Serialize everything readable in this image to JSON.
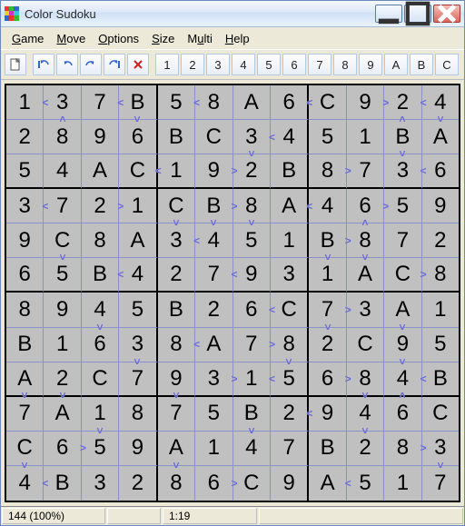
{
  "window": {
    "title": "Color Sudoku"
  },
  "menu": {
    "items": [
      {
        "label": "Game",
        "ul": 0
      },
      {
        "label": "Move",
        "ul": 0
      },
      {
        "label": "Options",
        "ul": 0
      },
      {
        "label": "Size",
        "ul": 0
      },
      {
        "label": "Multi",
        "ul": 1
      },
      {
        "label": "Help",
        "ul": 0
      }
    ]
  },
  "toolbar": {
    "new_icon": "new-file-icon",
    "undo_icons": [
      "undo-step-icon",
      "undo-icon",
      "redo-icon",
      "redo-step-icon"
    ],
    "cancel_icon": "cancel-icon",
    "numbers": [
      "1",
      "2",
      "3",
      "4",
      "5",
      "6",
      "7",
      "8",
      "9",
      "A",
      "B",
      "C"
    ]
  },
  "grid": [
    [
      "1",
      "3",
      "7",
      "B",
      "5",
      "8",
      "A",
      "6",
      "C",
      "9",
      "2",
      "4"
    ],
    [
      "2",
      "8",
      "9",
      "6",
      "B",
      "C",
      "3",
      "4",
      "5",
      "1",
      "B",
      "A"
    ],
    [
      "5",
      "4",
      "A",
      "C",
      "1",
      "9",
      "2",
      "B",
      "8",
      "7",
      "3",
      "6"
    ],
    [
      "3",
      "7",
      "2",
      "1",
      "C",
      "B",
      "8",
      "A",
      "4",
      "6",
      "5",
      "9"
    ],
    [
      "9",
      "C",
      "8",
      "A",
      "3",
      "4",
      "5",
      "1",
      "B",
      "8",
      "7",
      "2"
    ],
    [
      "6",
      "5",
      "B",
      "4",
      "2",
      "7",
      "9",
      "3",
      "1",
      "A",
      "C",
      "8"
    ],
    [
      "8",
      "9",
      "4",
      "5",
      "B",
      "2",
      "6",
      "C",
      "7",
      "3",
      "A",
      "1"
    ],
    [
      "B",
      "1",
      "6",
      "3",
      "8",
      "A",
      "7",
      "8",
      "2",
      "C",
      "9",
      "5"
    ],
    [
      "A",
      "2",
      "C",
      "7",
      "9",
      "3",
      "1",
      "5",
      "6",
      "8",
      "4",
      "B"
    ],
    [
      "7",
      "A",
      "1",
      "8",
      "7",
      "5",
      "B",
      "2",
      "9",
      "4",
      "6",
      "C"
    ],
    [
      "C",
      "6",
      "5",
      "9",
      "A",
      "1",
      "4",
      "7",
      "B",
      "2",
      "8",
      "3"
    ],
    [
      "4",
      "B",
      "3",
      "2",
      "8",
      "6",
      "C",
      "9",
      "A",
      "5",
      "1",
      "7"
    ]
  ],
  "hints_right": {
    "0": {
      "0": "<",
      "2": "<",
      "4": "<",
      "7": "<",
      "9": ">",
      "10": "<"
    },
    "1": {
      "6": "<"
    },
    "2": {
      "3": "<",
      "5": ">",
      "8": ">",
      "10": "<"
    },
    "3": {
      "0": "<",
      "2": ">",
      "5": ">",
      "7": "<",
      "9": ">"
    },
    "4": {
      "4": "<",
      "8": ">"
    },
    "5": {
      "2": "<",
      "5": "<",
      "10": ">"
    },
    "6": {
      "6": "<",
      "8": ">"
    },
    "7": {
      "4": "<",
      "6": ">"
    },
    "8": {
      "5": ">",
      "6": "<",
      "8": ">",
      "10": "<"
    },
    "9": {
      "7": "<"
    },
    "10": {
      "1": ">",
      "10": ">"
    },
    "11": {
      "0": "<",
      "5": ">",
      "8": "<"
    }
  },
  "hints_bottom": {
    "0": {
      "1": "<",
      "3": ">",
      "10": "<",
      "11": ">"
    },
    "1": {
      "6": ">",
      "10": ">"
    },
    "2": {},
    "3": {
      "4": ">",
      "5": ">",
      "6": ">",
      "9": "<"
    },
    "4": {
      "1": ">",
      "8": ">",
      "9": ">"
    },
    "5": {},
    "6": {
      "2": ">",
      "8": ">",
      "10": ">"
    },
    "7": {
      "3": ">",
      "7": ">",
      "10": ">"
    },
    "8": {
      "0": ">",
      "1": ">",
      "4": ">",
      "9": ">",
      "10": "<"
    },
    "9": {
      "2": ">",
      "6": ">",
      "9": ">"
    },
    "10": {
      "0": ">",
      "4": ">",
      "11": ">"
    }
  },
  "status": {
    "left": "144 (100%)",
    "time": "1:19"
  }
}
